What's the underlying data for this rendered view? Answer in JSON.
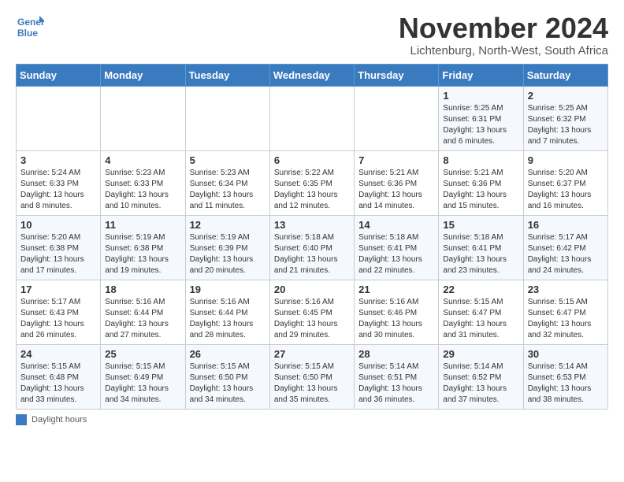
{
  "logo": {
    "line1": "General",
    "line2": "Blue"
  },
  "title": "November 2024",
  "subtitle": "Lichtenburg, North-West, South Africa",
  "weekdays": [
    "Sunday",
    "Monday",
    "Tuesday",
    "Wednesday",
    "Thursday",
    "Friday",
    "Saturday"
  ],
  "legend_label": "Daylight hours",
  "weeks": [
    [
      {
        "day": "",
        "info": ""
      },
      {
        "day": "",
        "info": ""
      },
      {
        "day": "",
        "info": ""
      },
      {
        "day": "",
        "info": ""
      },
      {
        "day": "",
        "info": ""
      },
      {
        "day": "1",
        "info": "Sunrise: 5:25 AM\nSunset: 6:31 PM\nDaylight: 13 hours\nand 6 minutes."
      },
      {
        "day": "2",
        "info": "Sunrise: 5:25 AM\nSunset: 6:32 PM\nDaylight: 13 hours\nand 7 minutes."
      }
    ],
    [
      {
        "day": "3",
        "info": "Sunrise: 5:24 AM\nSunset: 6:33 PM\nDaylight: 13 hours\nand 8 minutes."
      },
      {
        "day": "4",
        "info": "Sunrise: 5:23 AM\nSunset: 6:33 PM\nDaylight: 13 hours\nand 10 minutes."
      },
      {
        "day": "5",
        "info": "Sunrise: 5:23 AM\nSunset: 6:34 PM\nDaylight: 13 hours\nand 11 minutes."
      },
      {
        "day": "6",
        "info": "Sunrise: 5:22 AM\nSunset: 6:35 PM\nDaylight: 13 hours\nand 12 minutes."
      },
      {
        "day": "7",
        "info": "Sunrise: 5:21 AM\nSunset: 6:36 PM\nDaylight: 13 hours\nand 14 minutes."
      },
      {
        "day": "8",
        "info": "Sunrise: 5:21 AM\nSunset: 6:36 PM\nDaylight: 13 hours\nand 15 minutes."
      },
      {
        "day": "9",
        "info": "Sunrise: 5:20 AM\nSunset: 6:37 PM\nDaylight: 13 hours\nand 16 minutes."
      }
    ],
    [
      {
        "day": "10",
        "info": "Sunrise: 5:20 AM\nSunset: 6:38 PM\nDaylight: 13 hours\nand 17 minutes."
      },
      {
        "day": "11",
        "info": "Sunrise: 5:19 AM\nSunset: 6:38 PM\nDaylight: 13 hours\nand 19 minutes."
      },
      {
        "day": "12",
        "info": "Sunrise: 5:19 AM\nSunset: 6:39 PM\nDaylight: 13 hours\nand 20 minutes."
      },
      {
        "day": "13",
        "info": "Sunrise: 5:18 AM\nSunset: 6:40 PM\nDaylight: 13 hours\nand 21 minutes."
      },
      {
        "day": "14",
        "info": "Sunrise: 5:18 AM\nSunset: 6:41 PM\nDaylight: 13 hours\nand 22 minutes."
      },
      {
        "day": "15",
        "info": "Sunrise: 5:18 AM\nSunset: 6:41 PM\nDaylight: 13 hours\nand 23 minutes."
      },
      {
        "day": "16",
        "info": "Sunrise: 5:17 AM\nSunset: 6:42 PM\nDaylight: 13 hours\nand 24 minutes."
      }
    ],
    [
      {
        "day": "17",
        "info": "Sunrise: 5:17 AM\nSunset: 6:43 PM\nDaylight: 13 hours\nand 26 minutes."
      },
      {
        "day": "18",
        "info": "Sunrise: 5:16 AM\nSunset: 6:44 PM\nDaylight: 13 hours\nand 27 minutes."
      },
      {
        "day": "19",
        "info": "Sunrise: 5:16 AM\nSunset: 6:44 PM\nDaylight: 13 hours\nand 28 minutes."
      },
      {
        "day": "20",
        "info": "Sunrise: 5:16 AM\nSunset: 6:45 PM\nDaylight: 13 hours\nand 29 minutes."
      },
      {
        "day": "21",
        "info": "Sunrise: 5:16 AM\nSunset: 6:46 PM\nDaylight: 13 hours\nand 30 minutes."
      },
      {
        "day": "22",
        "info": "Sunrise: 5:15 AM\nSunset: 6:47 PM\nDaylight: 13 hours\nand 31 minutes."
      },
      {
        "day": "23",
        "info": "Sunrise: 5:15 AM\nSunset: 6:47 PM\nDaylight: 13 hours\nand 32 minutes."
      }
    ],
    [
      {
        "day": "24",
        "info": "Sunrise: 5:15 AM\nSunset: 6:48 PM\nDaylight: 13 hours\nand 33 minutes."
      },
      {
        "day": "25",
        "info": "Sunrise: 5:15 AM\nSunset: 6:49 PM\nDaylight: 13 hours\nand 34 minutes."
      },
      {
        "day": "26",
        "info": "Sunrise: 5:15 AM\nSunset: 6:50 PM\nDaylight: 13 hours\nand 34 minutes."
      },
      {
        "day": "27",
        "info": "Sunrise: 5:15 AM\nSunset: 6:50 PM\nDaylight: 13 hours\nand 35 minutes."
      },
      {
        "day": "28",
        "info": "Sunrise: 5:14 AM\nSunset: 6:51 PM\nDaylight: 13 hours\nand 36 minutes."
      },
      {
        "day": "29",
        "info": "Sunrise: 5:14 AM\nSunset: 6:52 PM\nDaylight: 13 hours\nand 37 minutes."
      },
      {
        "day": "30",
        "info": "Sunrise: 5:14 AM\nSunset: 6:53 PM\nDaylight: 13 hours\nand 38 minutes."
      }
    ]
  ]
}
